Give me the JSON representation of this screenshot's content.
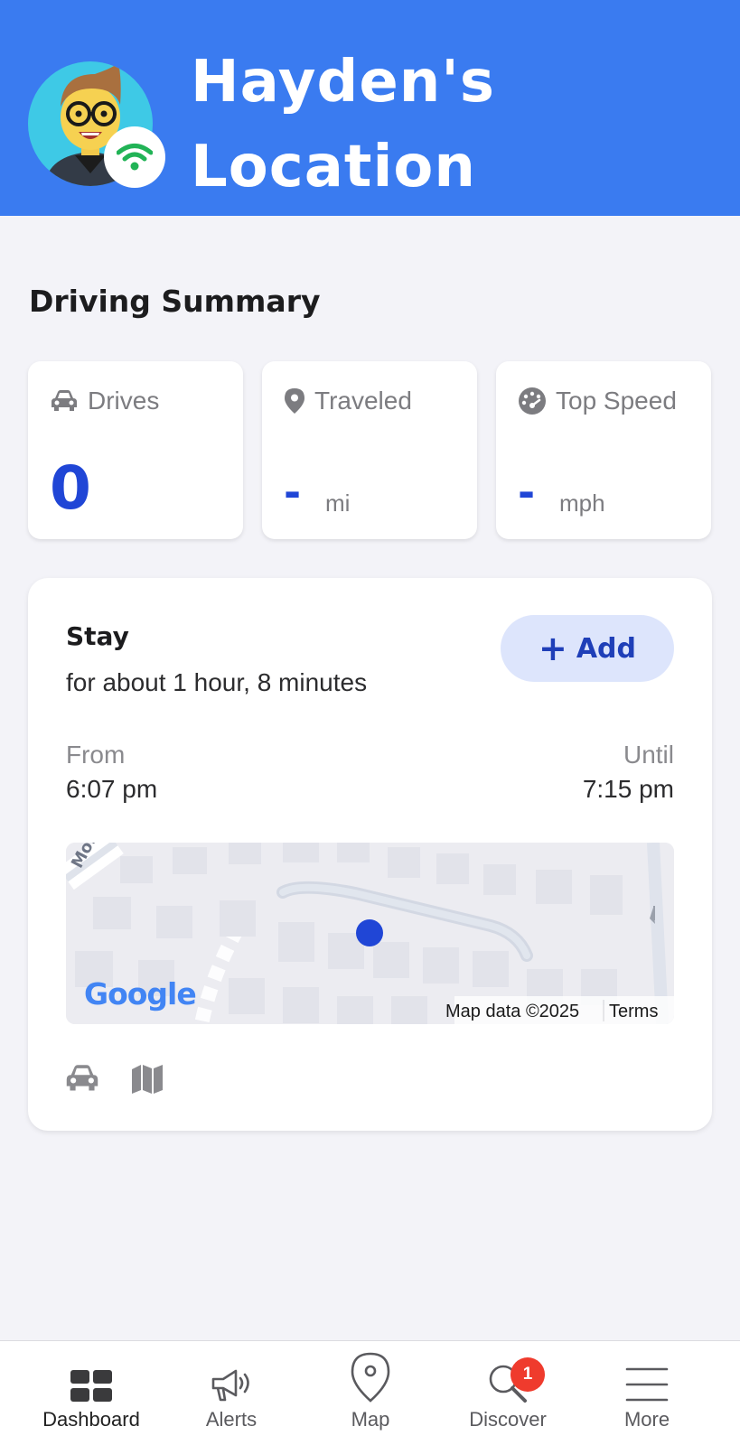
{
  "header": {
    "title_line1": "Hayden's",
    "title_line2": "Location",
    "avatar_icon": "avatar-image",
    "status_icon": "wifi-icon",
    "status_color": "#21b356",
    "background": "#3a7bf0"
  },
  "driving_summary": {
    "title": "Driving Summary",
    "cards": [
      {
        "label": "Drives",
        "icon": "car-icon",
        "value": "0",
        "unit": ""
      },
      {
        "label": "Traveled",
        "icon": "location-pin-icon",
        "value": "-",
        "unit": "mi"
      },
      {
        "label": "Top Speed",
        "icon": "speedometer-icon",
        "value": "-",
        "unit": "mph"
      }
    ]
  },
  "stay": {
    "title": "Stay",
    "subtitle": "for about 1 hour, 8 minutes",
    "add_label": "Add",
    "from_label": "From",
    "from_value": "6:07 pm",
    "until_label": "Until",
    "until_value": "7:15 pm",
    "map": {
      "street_label": "Morni",
      "google_logo": "Google",
      "map_data": "Map data ©2025",
      "terms": "Terms"
    },
    "footer_icons": [
      "car-icon",
      "map-icon"
    ]
  },
  "tabbar": {
    "tabs": [
      {
        "label": "Dashboard",
        "icon": "dashboard-icon",
        "active": true
      },
      {
        "label": "Alerts",
        "icon": "megaphone-icon"
      },
      {
        "label": "Map",
        "icon": "map-pin-icon"
      },
      {
        "label": "Discover",
        "icon": "search-icon",
        "badge": "1"
      },
      {
        "label": "More",
        "icon": "menu-icon"
      }
    ]
  }
}
